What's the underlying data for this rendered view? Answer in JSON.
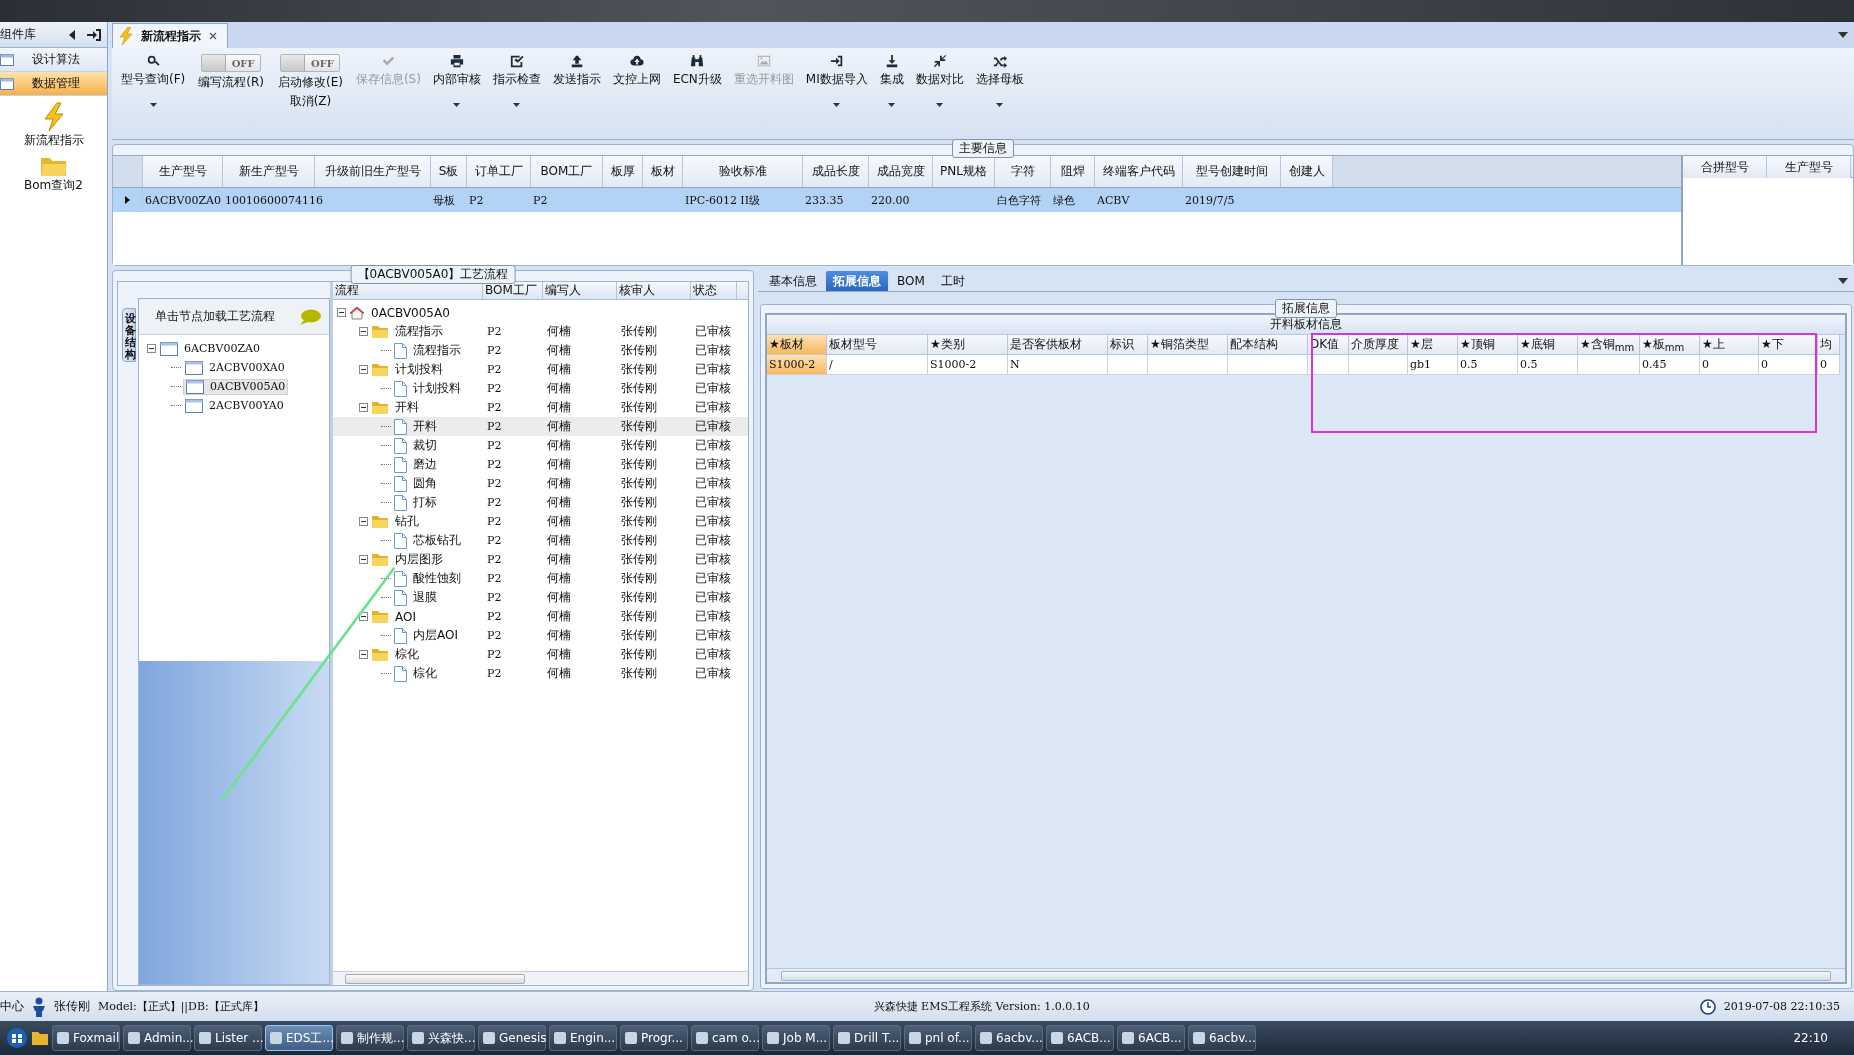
{
  "window": {
    "tab": "新流程指示"
  },
  "sidebar": {
    "title": "组件库",
    "items": [
      {
        "label": "设计算法",
        "selected": false
      },
      {
        "label": "数据管理",
        "selected": true
      }
    ],
    "tools": [
      {
        "label": "新流程指示"
      },
      {
        "label": "Bom查询2"
      }
    ]
  },
  "toolbar": [
    {
      "kind": "button",
      "label": "型号查询(F)",
      "disabled": false,
      "dropdown": true
    },
    {
      "kind": "toggle",
      "label": "编写流程(R)",
      "toggle_text": "OFF",
      "on": false
    },
    {
      "kind": "toggle",
      "label": "启动修改(E)",
      "label2": "取消(Z)",
      "toggle_text": "OFF",
      "on": false
    },
    {
      "kind": "button",
      "label": "保存信息(S)",
      "disabled": true,
      "dropdown": false
    },
    {
      "kind": "button",
      "label": "内部审核",
      "disabled": false,
      "dropdown": true
    },
    {
      "kind": "button",
      "label": "指示检查",
      "disabled": false,
      "dropdown": true
    },
    {
      "kind": "button",
      "label": "发送指示",
      "disabled": false,
      "dropdown": false
    },
    {
      "kind": "button",
      "label": "文控上网",
      "disabled": false,
      "dropdown": false
    },
    {
      "kind": "button",
      "label": "ECN升级",
      "disabled": false,
      "dropdown": false
    },
    {
      "kind": "button",
      "label": "重选开料图",
      "disabled": true,
      "dropdown": false
    },
    {
      "kind": "button",
      "label": "MI数据导入",
      "disabled": false,
      "dropdown": true
    },
    {
      "kind": "button",
      "label": "集成",
      "disabled": false,
      "dropdown": true
    },
    {
      "kind": "button",
      "label": "数据对比",
      "disabled": false,
      "dropdown": true
    },
    {
      "kind": "button",
      "label": "选择母板",
      "disabled": false,
      "dropdown": true
    }
  ],
  "main_info": {
    "title": "主要信息",
    "columns": [
      "生产型号",
      "新生产型号",
      "升级前旧生产型号",
      "S板",
      "订单工厂",
      "BOM工厂",
      "板厚",
      "板材",
      "验收标准",
      "成品长度",
      "成品宽度",
      "PNL规格",
      "字符",
      "阻焊",
      "终端客户代码",
      "型号创建时间",
      "创建人"
    ],
    "rows": [
      {
        "selected": true,
        "cells": [
          "6ACBV00ZA0",
          "10010600074116",
          null,
          "母板",
          "P2",
          "P2",
          null,
          null,
          "IPC-6012 II级",
          "233.35",
          "220.00",
          null,
          "白色字符",
          "绿色",
          "ACBV",
          "2019/7/5",
          null
        ]
      }
    ],
    "side_columns": [
      "合拼型号",
      "生产型号"
    ]
  },
  "process": {
    "title": "【0ACBV005A0】工艺流程",
    "side_tab": "设备结构",
    "hint": "单击节点加载工艺流程",
    "device_tree": [
      {
        "label": "6ACBV00ZA0",
        "expanded": true,
        "selected": false,
        "children": [
          {
            "label": "2ACBV00XA0",
            "selected": false
          },
          {
            "label": "0ACBV005A0",
            "selected": true
          },
          {
            "label": "2ACBV00YA0",
            "selected": false
          }
        ]
      }
    ],
    "columns": [
      "流程",
      "BOM工厂",
      "编写人",
      "核审人",
      "状态"
    ],
    "tree": [
      {
        "label": "0ACBV005A0",
        "expanded": true,
        "selected": false,
        "children": [
          {
            "label": "流程指示",
            "bom": "P2",
            "writer": "何楠",
            "reviewer": "张传刚",
            "status": "已审核",
            "expanded": true,
            "selected": false,
            "children": [
              {
                "label": "流程指示",
                "bom": "P2",
                "writer": "何楠",
                "reviewer": "张传刚",
                "status": "已审核",
                "selected": false
              }
            ]
          },
          {
            "label": "计划投料",
            "bom": "P2",
            "writer": "何楠",
            "reviewer": "张传刚",
            "status": "已审核",
            "expanded": true,
            "selected": false,
            "children": [
              {
                "label": "计划投料",
                "bom": "P2",
                "writer": "何楠",
                "reviewer": "张传刚",
                "status": "已审核",
                "selected": false
              }
            ]
          },
          {
            "label": "开料",
            "bom": "P2",
            "writer": "何楠",
            "reviewer": "张传刚",
            "status": "已审核",
            "expanded": true,
            "selected": false,
            "children": [
              {
                "label": "开料",
                "bom": "P2",
                "writer": "何楠",
                "reviewer": "张传刚",
                "status": "已审核",
                "selected": true
              },
              {
                "label": "裁切",
                "bom": "P2",
                "writer": "何楠",
                "reviewer": "张传刚",
                "status": "已审核",
                "selected": false
              },
              {
                "label": "磨边",
                "bom": "P2",
                "writer": "何楠",
                "reviewer": "张传刚",
                "status": "已审核",
                "selected": false
              },
              {
                "label": "圆角",
                "bom": "P2",
                "writer": "何楠",
                "reviewer": "张传刚",
                "status": "已审核",
                "selected": false
              },
              {
                "label": "打标",
                "bom": "P2",
                "writer": "何楠",
                "reviewer": "张传刚",
                "status": "已审核",
                "selected": false
              }
            ]
          },
          {
            "label": "钻孔",
            "bom": "P2",
            "writer": "何楠",
            "reviewer": "张传刚",
            "status": "已审核",
            "expanded": true,
            "selected": false,
            "children": [
              {
                "label": "芯板钻孔",
                "bom": "P2",
                "writer": "何楠",
                "reviewer": "张传刚",
                "status": "已审核",
                "selected": false
              }
            ]
          },
          {
            "label": "内层图形",
            "bom": "P2",
            "writer": "何楠",
            "reviewer": "张传刚",
            "status": "已审核",
            "expanded": true,
            "selected": false,
            "children": [
              {
                "label": "酸性蚀刻",
                "bom": "P2",
                "writer": "何楠",
                "reviewer": "张传刚",
                "status": "已审核",
                "selected": false
              },
              {
                "label": "退膜",
                "bom": "P2",
                "writer": "何楠",
                "reviewer": "张传刚",
                "status": "已审核",
                "selected": false
              }
            ]
          },
          {
            "label": "AOI",
            "bom": "P2",
            "writer": "何楠",
            "reviewer": "张传刚",
            "status": "已审核",
            "expanded": true,
            "selected": false,
            "children": [
              {
                "label": "内层AOI",
                "bom": "P2",
                "writer": "何楠",
                "reviewer": "张传刚",
                "status": "已审核",
                "selected": false
              }
            ]
          },
          {
            "label": "棕化",
            "bom": "P2",
            "writer": "何楠",
            "reviewer": "张传刚",
            "status": "已审核",
            "expanded": true,
            "selected": false,
            "children": [
              {
                "label": "棕化",
                "bom": "P2",
                "writer": "何楠",
                "reviewer": "张传刚",
                "status": "已审核",
                "selected": false
              }
            ]
          }
        ]
      }
    ]
  },
  "detail": {
    "tabs": [
      {
        "label": "基本信息",
        "selected": false
      },
      {
        "label": "拓展信息",
        "selected": true
      },
      {
        "label": "BOM",
        "selected": false
      },
      {
        "label": "工时",
        "selected": false
      }
    ],
    "section_title": "拓展信息",
    "table_title": "开料板材信息",
    "columns": [
      {
        "label": "★板材",
        "selected": true
      },
      {
        "label": "板材型号",
        "selected": false
      },
      {
        "label": "★类别",
        "selected": false
      },
      {
        "label": "是否客供板材",
        "selected": false
      },
      {
        "label": "标识",
        "selected": false
      },
      {
        "label": "★铜箔类型",
        "selected": false
      },
      {
        "label": "配本结构",
        "selected": false
      },
      {
        "label": "DK值",
        "selected": false
      },
      {
        "label": "介质厚度",
        "selected": false
      },
      {
        "label": "★层",
        "selected": false
      },
      {
        "label": "★顶铜",
        "selected": false
      },
      {
        "label": "★底铜",
        "selected": false
      },
      {
        "label": "★含铜$_{mm}$",
        "selected": false
      },
      {
        "label": "★板$_{mm}$",
        "selected": false
      },
      {
        "label": "★上",
        "selected": false
      },
      {
        "label": "★下",
        "selected": false
      },
      {
        "label": "均",
        "selected": false
      }
    ],
    "rows": [
      {
        "cells": [
          "S1000-2",
          "/",
          "S1000-2",
          "N",
          null,
          null,
          null,
          null,
          null,
          "gb1",
          "0.5",
          "0.5",
          null,
          "0.45",
          "0",
          "0",
          "0"
        ]
      }
    ]
  },
  "status_bar": {
    "left": "中心",
    "user": "张传刚",
    "model": "Model:【正式】||DB:【正式库】",
    "app": "兴森快捷 EMS工程系统 Version: 1.0.0.10",
    "datetime": "2019-07-08 22:10:35"
  },
  "taskbar": {
    "apps": [
      {
        "label": "Foxmail",
        "selected": false
      },
      {
        "label": "Admin...",
        "selected": false
      },
      {
        "label": "Lister ...",
        "selected": false
      },
      {
        "label": "EDS工...",
        "selected": true
      },
      {
        "label": "制作规...",
        "selected": false
      },
      {
        "label": "兴森快...",
        "selected": false
      },
      {
        "label": "Genesis",
        "selected": false
      },
      {
        "label": "Engin...",
        "selected": false
      },
      {
        "label": "Progr...",
        "selected": false
      },
      {
        "label": "cam o...",
        "selected": false
      },
      {
        "label": "Job M...",
        "selected": false
      },
      {
        "label": "Drill T...",
        "selected": false
      },
      {
        "label": "pnl of...",
        "selected": false
      },
      {
        "label": "6acbv...",
        "selected": false
      },
      {
        "label": "6ACB...",
        "selected": false
      },
      {
        "label": "6ACB...",
        "selected": false
      },
      {
        "label": "6acbv...",
        "selected": false
      }
    ],
    "clock": "22:10"
  }
}
